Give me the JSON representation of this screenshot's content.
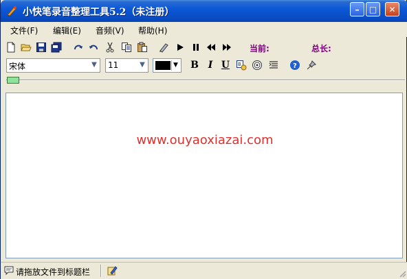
{
  "window": {
    "title": "小快笔录音整理工具5.2（未注册）"
  },
  "titlebar_buttons": {
    "minimize": "–",
    "maximize": "□",
    "close": "✕"
  },
  "menu": [
    {
      "label": "文件(F)"
    },
    {
      "label": "编辑(E)"
    },
    {
      "label": "音频(V)"
    },
    {
      "label": "帮助(H)"
    }
  ],
  "toolbar": {
    "current_label": "当前:",
    "total_label": "总长:"
  },
  "format": {
    "font_name": "宋体",
    "font_size": "11",
    "text_color": "#000000",
    "bold": "B",
    "italic": "I",
    "underline": "U"
  },
  "editor": {
    "content": "www.ouyaoxiazai.com"
  },
  "status": {
    "text": "请拖放文件到标题栏"
  },
  "colors": {
    "titlebar": "#0b58d8",
    "watermark": "#e0302c",
    "label": "#800080",
    "slider_thumb": "#8fe29a"
  }
}
